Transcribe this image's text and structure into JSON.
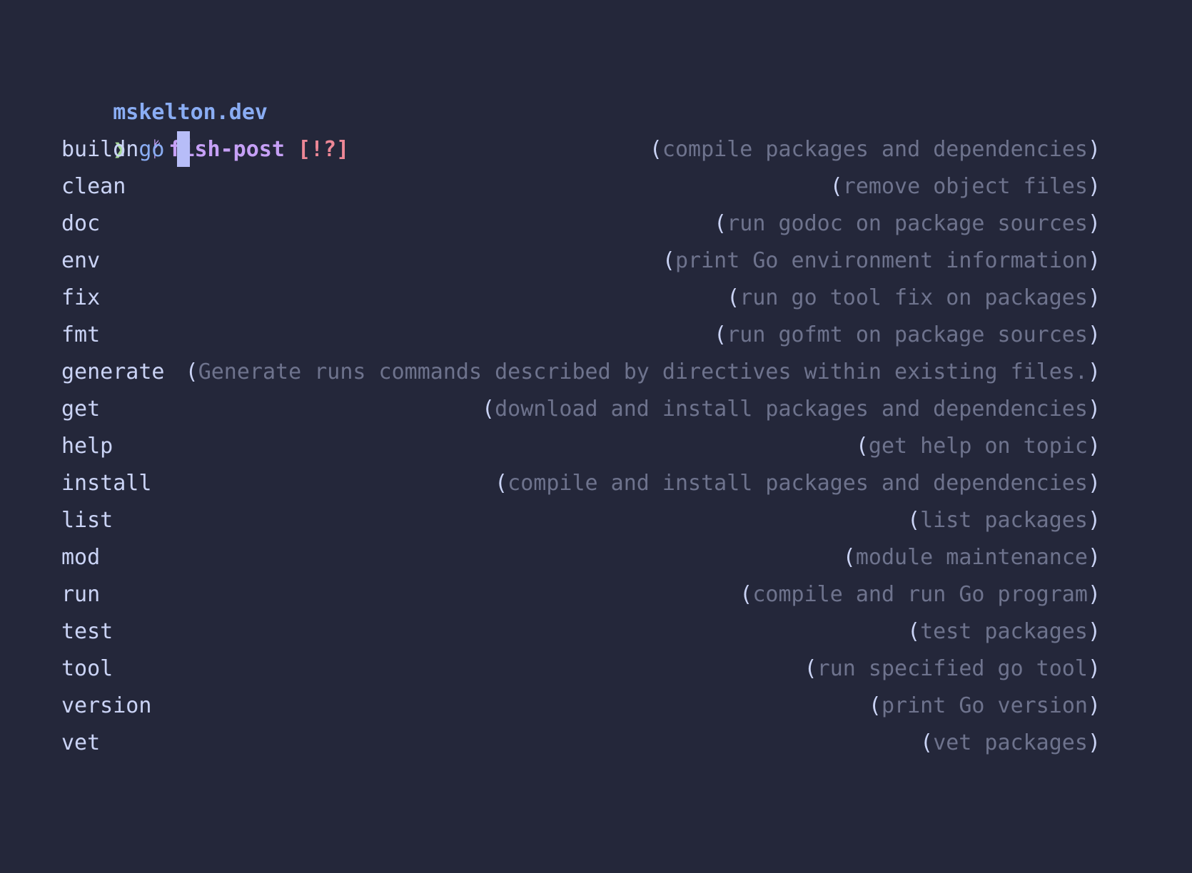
{
  "prompt": {
    "directory": "mskelton.dev",
    "on_text": "on",
    "branch_icon": "git-branch-icon",
    "branch_icon_glyph": "ᚠ",
    "branch": "fish-post",
    "status": "[!?]",
    "chevron": "❯",
    "command": "go"
  },
  "completions": [
    {
      "name": "build",
      "description": "compile packages and dependencies"
    },
    {
      "name": "clean",
      "description": "remove object files"
    },
    {
      "name": "doc",
      "description": "run godoc on package sources"
    },
    {
      "name": "env",
      "description": "print Go environment information"
    },
    {
      "name": "fix",
      "description": "run go tool fix on packages"
    },
    {
      "name": "fmt",
      "description": "run gofmt on package sources"
    },
    {
      "name": "generate",
      "description": "Generate runs commands described by directives within existing files."
    },
    {
      "name": "get",
      "description": "download and install packages and dependencies"
    },
    {
      "name": "help",
      "description": "get help on topic"
    },
    {
      "name": "install",
      "description": "compile and install packages and dependencies"
    },
    {
      "name": "list",
      "description": "list packages"
    },
    {
      "name": "mod",
      "description": "module maintenance"
    },
    {
      "name": "run",
      "description": "compile and run Go program"
    },
    {
      "name": "test",
      "description": "test packages"
    },
    {
      "name": "tool",
      "description": "run specified go tool"
    },
    {
      "name": "version",
      "description": "print Go version"
    },
    {
      "name": "vet",
      "description": "vet packages"
    }
  ],
  "colors": {
    "background": "#24273a",
    "text": "#cad3f5",
    "directory": "#8aadf4",
    "branch": "#c6a0f6",
    "status": "#ed8796",
    "chevron": "#a6da95",
    "description": "#6e738d",
    "cursor": "#b7bdf8"
  }
}
